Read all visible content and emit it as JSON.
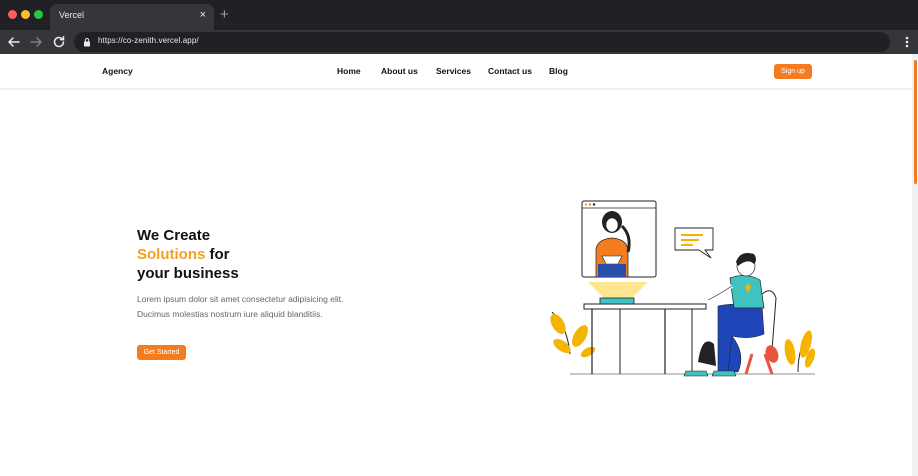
{
  "browser": {
    "tab_title": "Vercel",
    "tab_close": "×",
    "new_tab": "+",
    "url": "https://co-zenith.vercel.app/",
    "icons": [
      "back-arrow-icon",
      "forward-arrow-icon",
      "reload-icon",
      "lock-icon",
      "kebab-menu-icon"
    ]
  },
  "nav": {
    "brand": "Agency",
    "links": [
      "Home",
      "About us",
      "Services",
      "Contact us",
      "Blog"
    ],
    "signup": "Sign up"
  },
  "hero": {
    "title_line1": "We Create",
    "title_accent": "Solutions",
    "title_line2_rest": " for",
    "title_line3": "your business",
    "description": "Lorem ipsum dolor sit amet consectetur adipisicing elit. Ducimus molestias nostrum iure aliquid blanditiis.",
    "cta": "Get Started"
  },
  "colors": {
    "accent": "#f47c20",
    "accent_text": "#f5a020",
    "chrome_dark": "#202124",
    "chrome_mid": "#35363a"
  }
}
